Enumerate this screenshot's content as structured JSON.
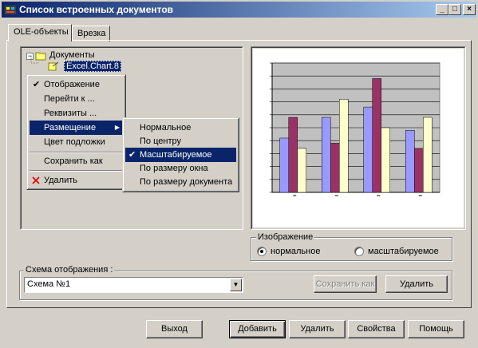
{
  "window": {
    "title": "Список встроенных документов"
  },
  "tabs": [
    {
      "label": "OLE-объекты"
    },
    {
      "label": "Врезка"
    }
  ],
  "tree": {
    "root_label": "Документы",
    "child_label": "Excel.Chart.8"
  },
  "context_menu": {
    "items": [
      {
        "label": "Отображение",
        "checked": true
      },
      {
        "label": "Перейти к ..."
      },
      {
        "label": "Реквизиты ..."
      },
      {
        "label": "Размещение",
        "submenu": true
      },
      {
        "label": "Цвет подложки"
      },
      {
        "label": "Сохранить как"
      },
      {
        "label": "Удалить",
        "icon": "delete-x-icon"
      }
    ]
  },
  "submenu": {
    "items": [
      {
        "label": "Нормальное"
      },
      {
        "label": "По центру"
      },
      {
        "label": "Масштабируемое",
        "checked": true
      },
      {
        "label": "По размеру окна"
      },
      {
        "label": "По размеру документа"
      }
    ]
  },
  "chart_data": {
    "type": "bar",
    "categories": [
      "",
      "",
      "",
      ""
    ],
    "ylim": [
      0,
      50
    ],
    "series": [
      {
        "color": "#9999ff",
        "values": [
          21,
          29,
          33,
          24
        ]
      },
      {
        "color": "#993366",
        "values": [
          29,
          19,
          44,
          17
        ]
      },
      {
        "color": "#ffffcc",
        "values": [
          17,
          36,
          25,
          29
        ]
      }
    ],
    "grid": true,
    "plot_background": "#c0c0c0"
  },
  "image_group": {
    "label": "Изображение",
    "options": [
      {
        "label": "нормальное",
        "selected": true
      },
      {
        "label": "масштабируемое",
        "selected": false
      }
    ]
  },
  "scheme_group": {
    "label": "Схема отображения :",
    "selected": "Схема №1",
    "save_label": "Сохранить как",
    "delete_label": "Удалить"
  },
  "footer": {
    "exit": "Выход",
    "add": "Добавить",
    "delete": "Удалить",
    "properties": "Свойства",
    "help": "Помощь"
  },
  "colors": {
    "titlebar_start": "#0a246a",
    "titlebar_end": "#a6caf0",
    "highlight": "#0a246a",
    "face": "#d4d0c8"
  }
}
